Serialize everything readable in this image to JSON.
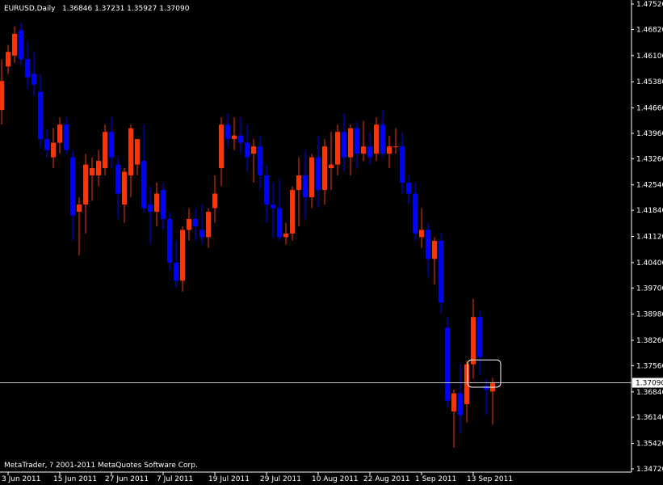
{
  "header": {
    "symbol": "EURUSD,Daily",
    "ohlc": "1.36846 1.37231 1.35927 1.37090"
  },
  "footer": {
    "copyright": "MetaTrader, ? 2001-2011 MetaQuotes Software Corp."
  },
  "colors": {
    "background": "#000000",
    "bull": "#ff3300",
    "bear": "#0000ff",
    "axis": "#ffffff",
    "price_line": "#c0c0c0",
    "highlight_box": "#ffffff"
  },
  "current_price": "1.37090",
  "chart_data": {
    "type": "candlestick",
    "title": "",
    "ylim": [
      1.3472,
      1.4752
    ],
    "y_ticks": [
      "1.47520",
      "1.46820",
      "1.46100",
      "1.45380",
      "1.44660",
      "1.43960",
      "1.43260",
      "1.42540",
      "1.41840",
      "1.41120",
      "1.40400",
      "1.39700",
      "1.38980",
      "1.38260",
      "1.37560",
      "1.36840",
      "1.36140",
      "1.35420",
      "1.34720"
    ],
    "x_ticks": [
      {
        "label": "3 Jun 2011",
        "index": 1
      },
      {
        "label": "15 Jun 2011",
        "index": 9
      },
      {
        "label": "27 Jun 2011",
        "index": 17
      },
      {
        "label": "7 Jul 2011",
        "index": 25
      },
      {
        "label": "19 Jul 2011",
        "index": 33
      },
      {
        "label": "29 Jul 2011",
        "index": 41
      },
      {
        "label": "10 Aug 2011",
        "index": 49
      },
      {
        "label": "22 Aug 2011",
        "index": 57
      },
      {
        "label": "1 Sep 2011",
        "index": 65
      },
      {
        "label": "13 Sep 2011",
        "index": 73
      }
    ],
    "candles": [
      {
        "o": 1.446,
        "h": 1.46,
        "l": 1.442,
        "c": 1.454
      },
      {
        "o": 1.458,
        "h": 1.464,
        "l": 1.456,
        "c": 1.462
      },
      {
        "o": 1.461,
        "h": 1.469,
        "l": 1.459,
        "c": 1.467
      },
      {
        "o": 1.468,
        "h": 1.47,
        "l": 1.458,
        "c": 1.46
      },
      {
        "o": 1.46,
        "h": 1.465,
        "l": 1.452,
        "c": 1.455
      },
      {
        "o": 1.456,
        "h": 1.462,
        "l": 1.45,
        "c": 1.453
      },
      {
        "o": 1.451,
        "h": 1.456,
        "l": 1.436,
        "c": 1.438
      },
      {
        "o": 1.438,
        "h": 1.441,
        "l": 1.433,
        "c": 1.435
      },
      {
        "o": 1.433,
        "h": 1.441,
        "l": 1.43,
        "c": 1.437
      },
      {
        "o": 1.437,
        "h": 1.444,
        "l": 1.434,
        "c": 1.442
      },
      {
        "o": 1.442,
        "h": 1.444,
        "l": 1.434,
        "c": 1.435
      },
      {
        "o": 1.433,
        "h": 1.435,
        "l": 1.41,
        "c": 1.417
      },
      {
        "o": 1.418,
        "h": 1.422,
        "l": 1.406,
        "c": 1.42
      },
      {
        "o": 1.42,
        "h": 1.434,
        "l": 1.412,
        "c": 1.431
      },
      {
        "o": 1.428,
        "h": 1.433,
        "l": 1.421,
        "c": 1.43
      },
      {
        "o": 1.428,
        "h": 1.435,
        "l": 1.425,
        "c": 1.432
      },
      {
        "o": 1.43,
        "h": 1.442,
        "l": 1.428,
        "c": 1.44
      },
      {
        "o": 1.44,
        "h": 1.444,
        "l": 1.43,
        "c": 1.433
      },
      {
        "o": 1.431,
        "h": 1.433,
        "l": 1.416,
        "c": 1.423
      },
      {
        "o": 1.42,
        "h": 1.43,
        "l": 1.415,
        "c": 1.429
      },
      {
        "o": 1.428,
        "h": 1.442,
        "l": 1.422,
        "c": 1.441
      },
      {
        "o": 1.431,
        "h": 1.438,
        "l": 1.428,
        "c": 1.438
      },
      {
        "o": 1.432,
        "h": 1.442,
        "l": 1.418,
        "c": 1.419
      },
      {
        "o": 1.42,
        "h": 1.425,
        "l": 1.409,
        "c": 1.418
      },
      {
        "o": 1.418,
        "h": 1.426,
        "l": 1.414,
        "c": 1.423
      },
      {
        "o": 1.424,
        "h": 1.426,
        "l": 1.413,
        "c": 1.416
      },
      {
        "o": 1.416,
        "h": 1.418,
        "l": 1.402,
        "c": 1.404
      },
      {
        "o": 1.404,
        "h": 1.41,
        "l": 1.397,
        "c": 1.399
      },
      {
        "o": 1.399,
        "h": 1.414,
        "l": 1.396,
        "c": 1.413
      },
      {
        "o": 1.413,
        "h": 1.419,
        "l": 1.41,
        "c": 1.416
      },
      {
        "o": 1.416,
        "h": 1.419,
        "l": 1.41,
        "c": 1.414
      },
      {
        "o": 1.413,
        "h": 1.42,
        "l": 1.409,
        "c": 1.411
      },
      {
        "o": 1.411,
        "h": 1.419,
        "l": 1.408,
        "c": 1.418
      },
      {
        "o": 1.419,
        "h": 1.428,
        "l": 1.415,
        "c": 1.423
      },
      {
        "o": 1.43,
        "h": 1.444,
        "l": 1.425,
        "c": 1.442
      },
      {
        "o": 1.442,
        "h": 1.445,
        "l": 1.436,
        "c": 1.438
      },
      {
        "o": 1.438,
        "h": 1.444,
        "l": 1.435,
        "c": 1.439
      },
      {
        "o": 1.439,
        "h": 1.444,
        "l": 1.434,
        "c": 1.437
      },
      {
        "o": 1.437,
        "h": 1.442,
        "l": 1.429,
        "c": 1.433
      },
      {
        "o": 1.434,
        "h": 1.438,
        "l": 1.426,
        "c": 1.436
      },
      {
        "o": 1.436,
        "h": 1.439,
        "l": 1.424,
        "c": 1.428
      },
      {
        "o": 1.428,
        "h": 1.431,
        "l": 1.415,
        "c": 1.42
      },
      {
        "o": 1.42,
        "h": 1.426,
        "l": 1.411,
        "c": 1.419
      },
      {
        "o": 1.419,
        "h": 1.427,
        "l": 1.41,
        "c": 1.411
      },
      {
        "o": 1.411,
        "h": 1.415,
        "l": 1.409,
        "c": 1.412
      },
      {
        "o": 1.412,
        "h": 1.425,
        "l": 1.41,
        "c": 1.424
      },
      {
        "o": 1.424,
        "h": 1.433,
        "l": 1.414,
        "c": 1.428
      },
      {
        "o": 1.428,
        "h": 1.435,
        "l": 1.416,
        "c": 1.422
      },
      {
        "o": 1.422,
        "h": 1.434,
        "l": 1.419,
        "c": 1.433
      },
      {
        "o": 1.433,
        "h": 1.439,
        "l": 1.419,
        "c": 1.424
      },
      {
        "o": 1.424,
        "h": 1.438,
        "l": 1.42,
        "c": 1.436
      },
      {
        "o": 1.43,
        "h": 1.44,
        "l": 1.424,
        "c": 1.431
      },
      {
        "o": 1.431,
        "h": 1.442,
        "l": 1.428,
        "c": 1.44
      },
      {
        "o": 1.44,
        "h": 1.445,
        "l": 1.429,
        "c": 1.433
      },
      {
        "o": 1.433,
        "h": 1.442,
        "l": 1.428,
        "c": 1.441
      },
      {
        "o": 1.441,
        "h": 1.443,
        "l": 1.43,
        "c": 1.434
      },
      {
        "o": 1.434,
        "h": 1.443,
        "l": 1.432,
        "c": 1.436
      },
      {
        "o": 1.436,
        "h": 1.44,
        "l": 1.431,
        "c": 1.433
      },
      {
        "o": 1.434,
        "h": 1.444,
        "l": 1.432,
        "c": 1.442
      },
      {
        "o": 1.442,
        "h": 1.446,
        "l": 1.433,
        "c": 1.434
      },
      {
        "o": 1.434,
        "h": 1.439,
        "l": 1.43,
        "c": 1.436
      },
      {
        "o": 1.436,
        "h": 1.441,
        "l": 1.434,
        "c": 1.436
      },
      {
        "o": 1.436,
        "h": 1.44,
        "l": 1.423,
        "c": 1.426
      },
      {
        "o": 1.426,
        "h": 1.428,
        "l": 1.42,
        "c": 1.423
      },
      {
        "o": 1.423,
        "h": 1.426,
        "l": 1.41,
        "c": 1.412
      },
      {
        "o": 1.411,
        "h": 1.419,
        "l": 1.408,
        "c": 1.413
      },
      {
        "o": 1.413,
        "h": 1.415,
        "l": 1.4,
        "c": 1.405
      },
      {
        "o": 1.405,
        "h": 1.411,
        "l": 1.398,
        "c": 1.41
      },
      {
        "o": 1.41,
        "h": 1.412,
        "l": 1.39,
        "c": 1.393
      },
      {
        "o": 1.386,
        "h": 1.389,
        "l": 1.364,
        "c": 1.366
      },
      {
        "o": 1.363,
        "h": 1.369,
        "l": 1.353,
        "c": 1.368
      },
      {
        "o": 1.368,
        "h": 1.376,
        "l": 1.357,
        "c": 1.362
      },
      {
        "o": 1.365,
        "h": 1.377,
        "l": 1.36,
        "c": 1.376
      },
      {
        "o": 1.376,
        "h": 1.394,
        "l": 1.372,
        "c": 1.389
      },
      {
        "o": 1.389,
        "h": 1.391,
        "l": 1.373,
        "c": 1.378
      },
      {
        "o": 1.37,
        "h": 1.372,
        "l": 1.362,
        "c": 1.369
      },
      {
        "o": 1.3685,
        "h": 1.3723,
        "l": 1.3593,
        "c": 1.3709
      }
    ],
    "highlight_box": {
      "from_index": 73,
      "to_index": 76,
      "y_top": 1.3772,
      "y_bottom": 1.3708
    }
  }
}
